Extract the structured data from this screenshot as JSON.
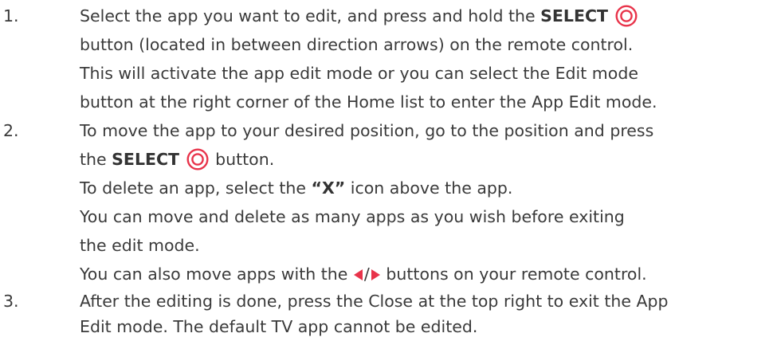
{
  "steps": [
    {
      "number": "1.",
      "lines": [
        {
          "pre": "Select the app you want to edit, and press and hold the ",
          "bold": "SELECT",
          "post": ""
        },
        {
          "text": "button (located in between direction arrows) on the remote control."
        },
        {
          "text": "This will activate the app edit mode or you can select the Edit mode"
        },
        {
          "text": "button at the right corner of the Home list to enter the App Edit mode."
        }
      ]
    },
    {
      "number": "2.",
      "lines": [
        {
          "text": "To move the app to your desired position, go to the position and press"
        },
        {
          "pre": "the ",
          "bold": "SELECT",
          "post": " button."
        },
        {
          "pre": "To delete an app, select the ",
          "bold": "“X”",
          "post": " icon above the app."
        },
        {
          "text": "You can move and delete as many apps as you wish before exiting"
        },
        {
          "text": "the edit mode."
        },
        {
          "pre": "You can also move apps with the ",
          "mid": "/",
          "post": " buttons on your remote control."
        }
      ]
    },
    {
      "number": "3.",
      "lines": [
        {
          "text": "After the editing is done, press the Close at the top right to exit the App"
        },
        {
          "text": "Edit mode. The default TV app cannot be edited."
        }
      ]
    }
  ],
  "colors": {
    "text": "#3a3a3a",
    "accent": "#e8334a"
  },
  "icons": {
    "select": "select-button-icon",
    "left": "left-arrow-icon",
    "right": "right-arrow-icon"
  }
}
